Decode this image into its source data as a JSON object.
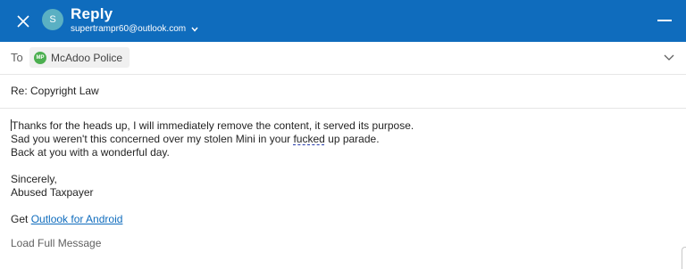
{
  "header": {
    "title": "Reply",
    "account_initial": "S",
    "account_email": "supertrampr60@outlook.com",
    "bg_color": "#0f6cbd"
  },
  "to": {
    "label": "To",
    "recipient": {
      "initials": "MP",
      "name": "McAdoo Police"
    }
  },
  "subject": "Re: Copyright Law",
  "message": {
    "line1": "Thanks for the heads up, I will immediately remove the content, it served its purpose.",
    "line2_before": "Sad you weren't this concerned over my stolen Mini in your ",
    "line2_flagged": "fucked",
    "line2_after": " up parade.",
    "line3": "Back at you with a wonderful day.",
    "closing": "Sincerely,",
    "signature": "Abused Taxpayer",
    "footer_prefix": "Get ",
    "footer_link": "Outlook for Android"
  },
  "load_full_label": "Load Full Message",
  "icons": {
    "close": "close-icon",
    "dropdown": "chevron-down-icon",
    "minimize": "minimize-icon",
    "expand": "chevron-down-icon"
  }
}
